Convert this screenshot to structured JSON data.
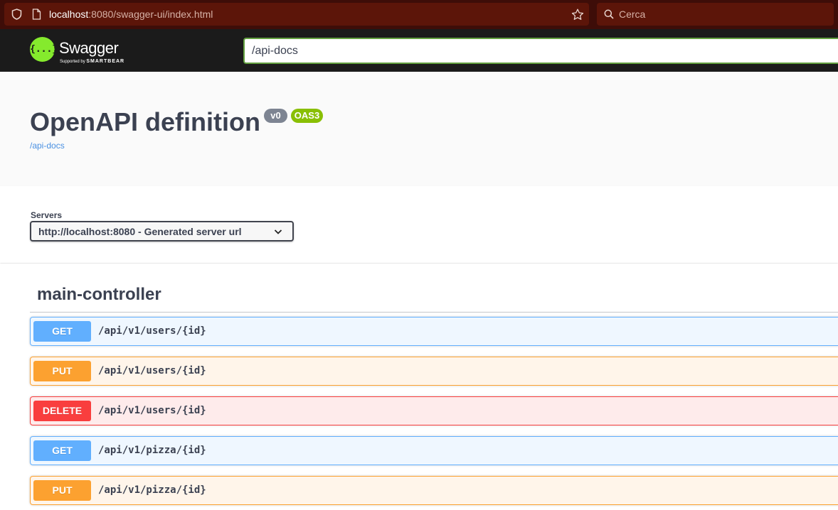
{
  "browser": {
    "url_host": "localhost",
    "url_rest": ":8080/swagger-ui/index.html",
    "search_placeholder": "Cerca"
  },
  "topbar": {
    "logo_symbol": "{...}",
    "logo_word": "Swagger",
    "logo_supported": "Supported by",
    "logo_smartbear": "SMARTBEAR",
    "spec_url_value": "/api-docs"
  },
  "info": {
    "title": "OpenAPI definition",
    "version_badge": "v0",
    "oas_badge": "OAS3",
    "spec_link": "/api-docs"
  },
  "servers": {
    "label": "Servers",
    "selected": "http://localhost:8080 - Generated server url"
  },
  "tag": {
    "name": "main-controller"
  },
  "operations": [
    {
      "method": "GET",
      "path": "/api/v1/users/{id}"
    },
    {
      "method": "PUT",
      "path": "/api/v1/users/{id}"
    },
    {
      "method": "DELETE",
      "path": "/api/v1/users/{id}"
    },
    {
      "method": "GET",
      "path": "/api/v1/pizza/{id}"
    },
    {
      "method": "PUT",
      "path": "/api/v1/pizza/{id}"
    }
  ],
  "colors": {
    "get": "#61affe",
    "put": "#fca130",
    "delete": "#f93e3e",
    "oas_badge": "#89bf04",
    "version_badge": "#7d8492",
    "topbar": "#1b1b1b",
    "browser_bar": "#3e0d08"
  },
  "icons": [
    "shield-icon",
    "page-icon",
    "star-icon",
    "search-icon",
    "swagger-logo-icon",
    "chevron-down-icon"
  ]
}
